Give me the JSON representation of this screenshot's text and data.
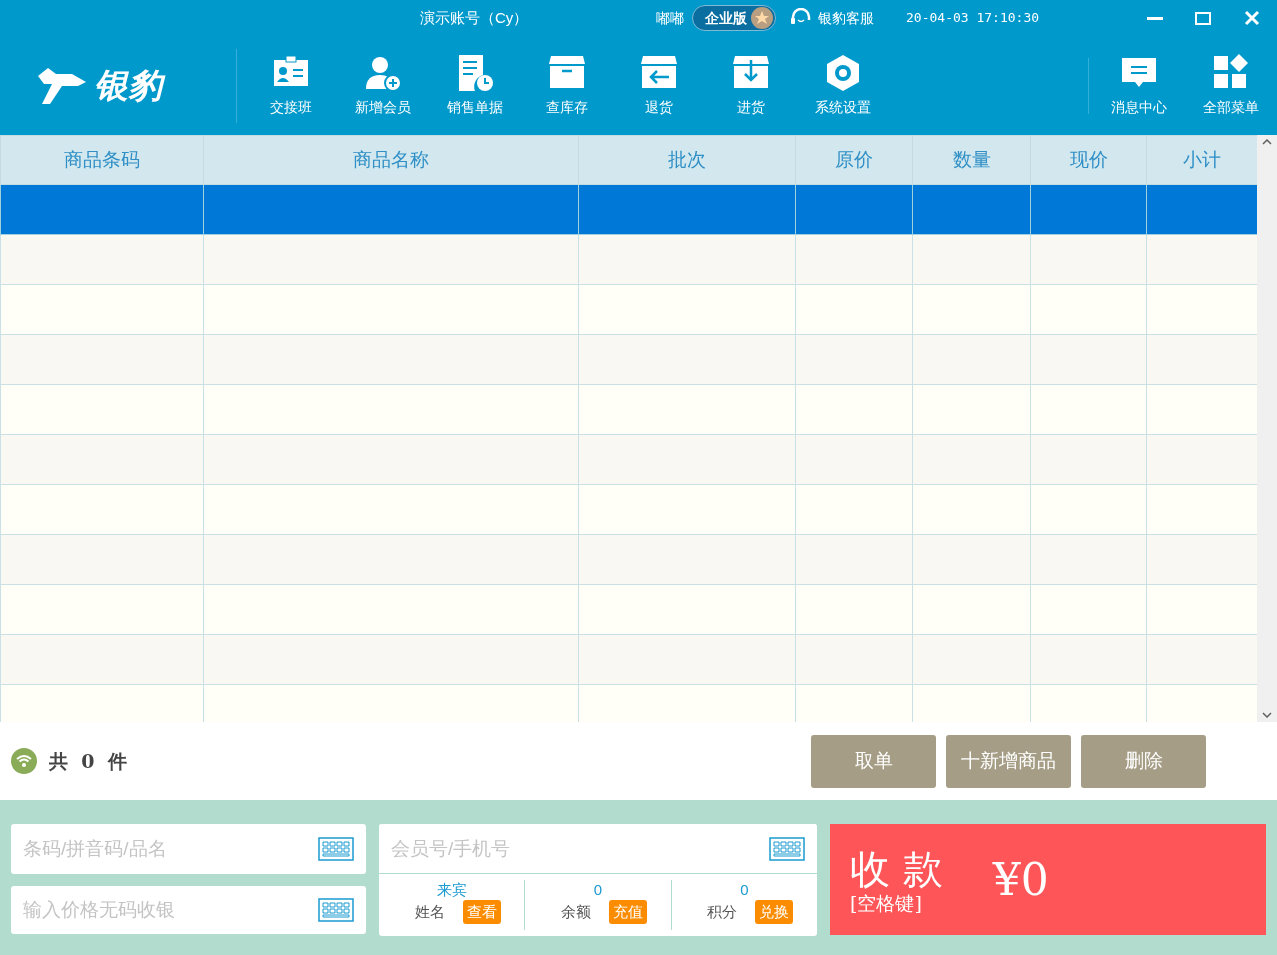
{
  "title_bar": {
    "account": "演示账号（Cy）",
    "user": "嘟嘟",
    "edition": "企业版",
    "support": "银豹客服",
    "datetime": "20-04-03 17:10:30"
  },
  "logo": "银豹",
  "toolbar": [
    {
      "label": "交接班",
      "kind": "badge"
    },
    {
      "label": "新增会员",
      "kind": "adduser"
    },
    {
      "label": "销售单据",
      "kind": "doc"
    },
    {
      "label": "查库存",
      "kind": "box"
    },
    {
      "label": "退货",
      "kind": "return"
    },
    {
      "label": "进货",
      "kind": "inbound"
    },
    {
      "label": "系统设置",
      "kind": "gear"
    }
  ],
  "toolbar_right": [
    {
      "label": "消息中心",
      "kind": "message"
    },
    {
      "label": "全部菜单",
      "kind": "grid"
    }
  ],
  "table": {
    "columns": [
      "商品条码",
      "商品名称",
      "批次",
      "原价",
      "数量",
      "现价",
      "小计"
    ],
    "rows": [
      {
        "selected": true
      },
      {
        "selected": false
      },
      {
        "selected": false
      },
      {
        "selected": false
      },
      {
        "selected": false
      },
      {
        "selected": false
      },
      {
        "selected": false
      },
      {
        "selected": false
      },
      {
        "selected": false
      },
      {
        "selected": false
      },
      {
        "selected": false
      }
    ]
  },
  "summary": {
    "prefix": "共",
    "count": "0",
    "suffix": "件"
  },
  "actions": [
    {
      "label": "取单"
    },
    {
      "label": "十新增商品"
    },
    {
      "label": "删除"
    }
  ],
  "barcode_field": {
    "placeholder": "条码/拼音码/品名"
  },
  "price_field": {
    "placeholder": "输入价格无码收银"
  },
  "member": {
    "field": {
      "placeholder": "会员号/手机号"
    },
    "stats": [
      {
        "value": "来宾",
        "label": "姓名",
        "button": "查看"
      },
      {
        "value": "0",
        "label": "余额",
        "button": "充值"
      },
      {
        "value": "0",
        "label": "积分",
        "button": "兑换"
      }
    ]
  },
  "checkout": {
    "title": "收 款",
    "hint": "[空格键]",
    "amount": "¥0"
  }
}
